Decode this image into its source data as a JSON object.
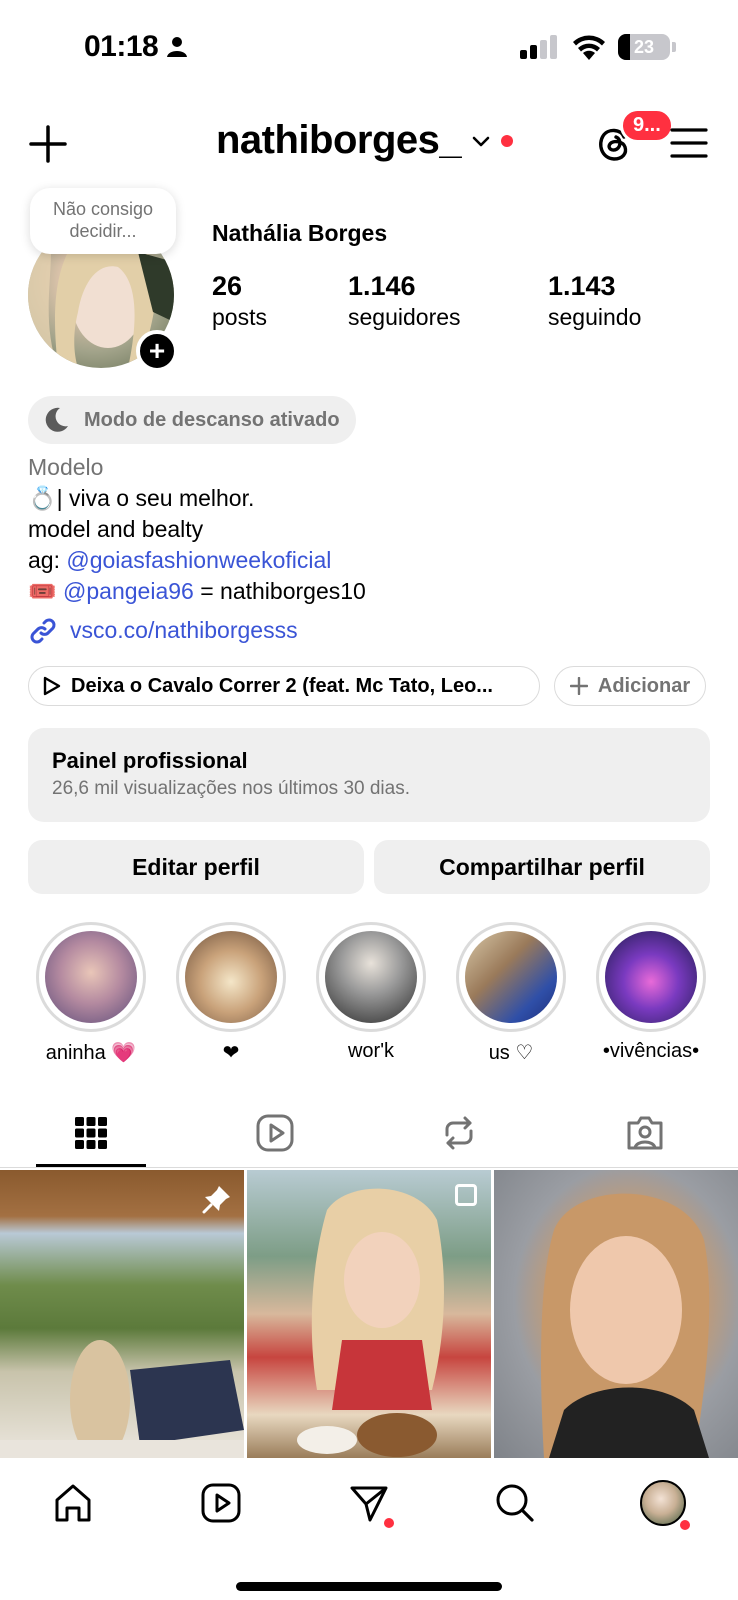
{
  "status_bar": {
    "time": "01:18",
    "battery": "23",
    "battery_level": 0.23
  },
  "header": {
    "username": "nathiborges_",
    "threads_badge": "9..."
  },
  "profile": {
    "note": "Não consigo decidir...",
    "display_name": "Nathália Borges",
    "stats": [
      {
        "value": "26",
        "label": "posts"
      },
      {
        "value": "1.146",
        "label": "seguidores"
      },
      {
        "value": "1.143",
        "label": "seguindo"
      }
    ],
    "rest_mode": "Modo de descanso ativado",
    "category": "Modelo",
    "bio_line1": "| viva o seu melhor.",
    "bio_line2": "model and bealty",
    "bio_ag_prefix": "ag: ",
    "bio_ag_mention": "@goiasfashionweekoficial",
    "bio_mention2": "@pangeia96",
    "bio_mention2_suffix": " = nathiborges10",
    "link": "vsco.co/nathiborgesss",
    "music": "Deixa o Cavalo Correr 2 (feat. Mc Tato, Leo...",
    "add_label": "Adicionar"
  },
  "dashboard": {
    "title": "Painel profissional",
    "subtitle": "26,6 mil visualizações nos últimos 30 dias."
  },
  "buttons": {
    "edit": "Editar perfil",
    "share": "Compartilhar perfil"
  },
  "highlights": [
    {
      "label": "aninha 💗",
      "color": "#b48aa0"
    },
    {
      "label": "❤",
      "color": "#c9a27a"
    },
    {
      "label": "wor'k",
      "color": "#6d6d6d"
    },
    {
      "label": "us ♡",
      "color": "#4d6db0"
    },
    {
      "label": "•vivências•",
      "color": "#5a3aa0"
    }
  ],
  "tabs": [
    "grid-icon",
    "reels-icon",
    "reposts-icon",
    "tagged-icon"
  ],
  "nav": [
    "home-icon",
    "reels-icon",
    "messages-icon",
    "search-icon",
    "profile-avatar"
  ],
  "colors": {
    "accent_blue": "#3a54d6",
    "badge_red": "#ff3040",
    "muted": "#737373",
    "pill_bg": "#efefef"
  }
}
